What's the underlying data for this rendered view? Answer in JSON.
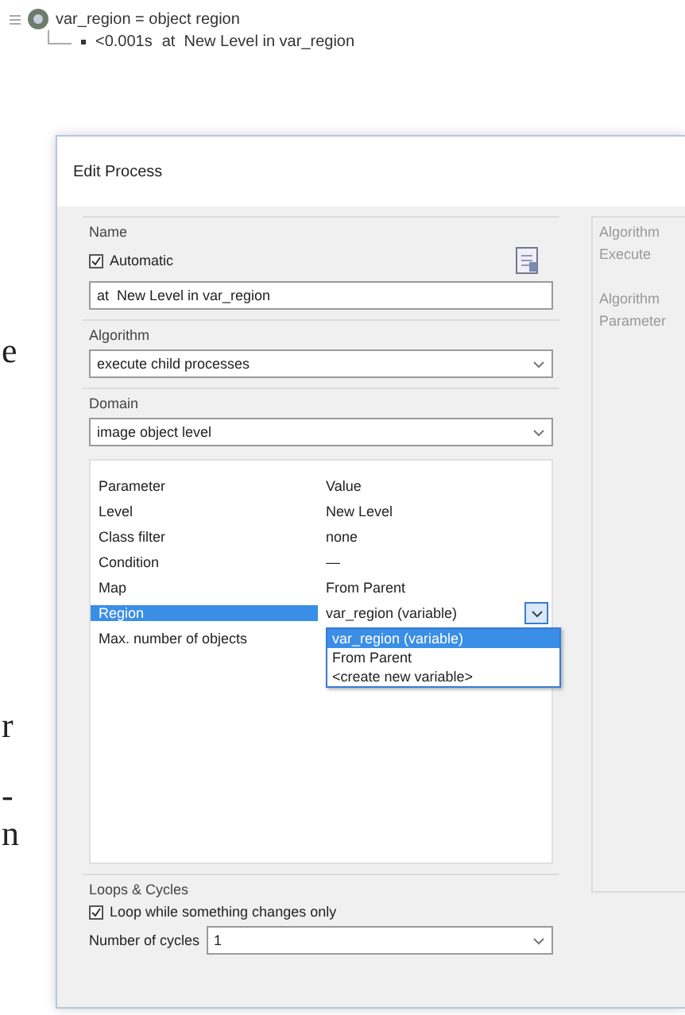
{
  "page_fragments": [
    "e",
    "r",
    "-",
    "n"
  ],
  "tree": {
    "label": "var_region = object region",
    "children": [
      {
        "time": "<0.001s",
        "label": "at  New Level in var_region"
      }
    ]
  },
  "dialog": {
    "title": "Edit Process",
    "name": {
      "heading": "Name",
      "automatic": {
        "label": "Automatic",
        "checked": true
      },
      "value": "at  New Level in var_region"
    },
    "algorithm": {
      "heading": "Algorithm",
      "value": "execute child processes"
    },
    "domain": {
      "heading": "Domain",
      "value": "image object level",
      "table": {
        "columns": [
          "Parameter",
          "Value"
        ],
        "rows": [
          {
            "parameter": "Level",
            "value": "New Level",
            "selected": false
          },
          {
            "parameter": "Class filter",
            "value": "none",
            "selected": false
          },
          {
            "parameter": "Condition",
            "value": "—",
            "selected": false
          },
          {
            "parameter": "Map",
            "value": "From Parent",
            "selected": false
          },
          {
            "parameter": "Region",
            "value": "var_region (variable)",
            "selected": true
          },
          {
            "parameter": "Max. number of objects",
            "value": "",
            "selected": false
          }
        ]
      },
      "dropdown": {
        "options": [
          {
            "label": "var_region (variable)",
            "selected": true
          },
          {
            "label": "From Parent",
            "selected": false
          },
          {
            "label": "<create new variable>",
            "selected": false
          }
        ]
      }
    },
    "loops": {
      "heading": "Loops & Cycles",
      "loop_check": {
        "label": "Loop while something changes only",
        "checked": true
      },
      "cycles_label": "Number of cycles",
      "cycles_value": "1"
    },
    "side_panel": {
      "texts": [
        "Algorithm",
        "Execute",
        "Algorithm",
        "Parameter"
      ]
    }
  }
}
